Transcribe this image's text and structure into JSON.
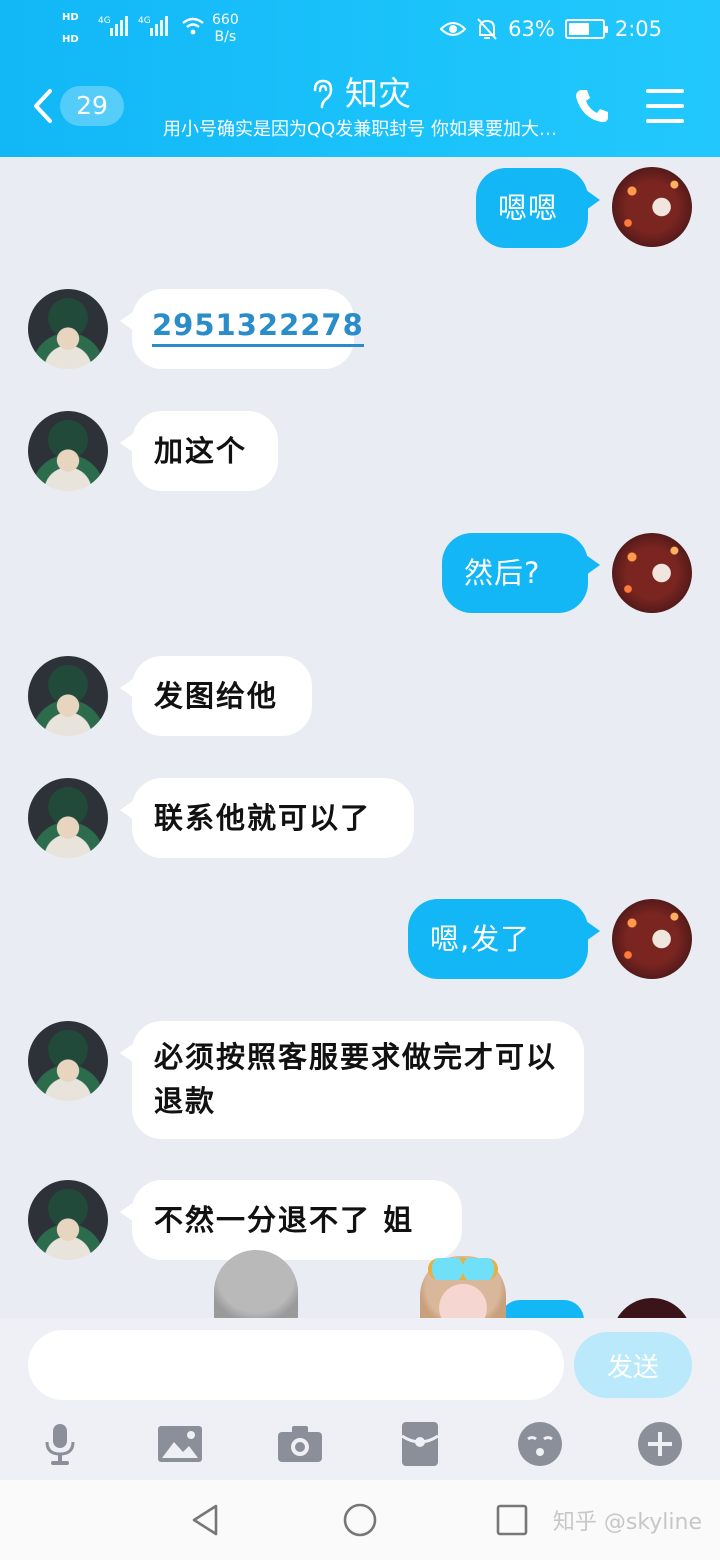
{
  "status_bar": {
    "hd1": "HD",
    "hd2": "HD",
    "net1": "4G",
    "net2": "4G",
    "speed_value": "660",
    "speed_unit": "B/s",
    "battery_percent": "63%",
    "battery_level": 0.63,
    "time": "2:05"
  },
  "header": {
    "unread_count": "29",
    "contact_name": "知灾",
    "subtitle": "用小号确实是因为QQ发兼职封号 你如果要加大…"
  },
  "messages": [
    {
      "side": "out",
      "text": "嗯嗯"
    },
    {
      "side": "in",
      "text": "2951322278",
      "is_link": true
    },
    {
      "side": "in",
      "text": "加这个"
    },
    {
      "side": "out",
      "text": "然后?"
    },
    {
      "side": "in",
      "text": "发图给他"
    },
    {
      "side": "in",
      "text": "联系他就可以了"
    },
    {
      "side": "out",
      "text": "嗯,发了"
    },
    {
      "side": "in",
      "text": "必须按照客服要求做完才可以退款"
    },
    {
      "side": "in",
      "text": "不然一分退不了 姐"
    }
  ],
  "input": {
    "placeholder": "",
    "send_label": "发送"
  },
  "toolbar_icons": [
    "microphone-icon",
    "image-icon",
    "camera-icon",
    "red-packet-icon",
    "emoji-icon",
    "plus-icon"
  ],
  "nav_icons": [
    "back-triangle-icon",
    "home-circle-icon",
    "recent-square-icon"
  ],
  "watermark": "知乎 @skyline",
  "colors": {
    "header": "#1bc3fb",
    "bubble_out": "#13b7f6",
    "bubble_in": "#ffffff",
    "chat_bg": "#e9ecf3",
    "icon_gray": "#8a8f99"
  }
}
